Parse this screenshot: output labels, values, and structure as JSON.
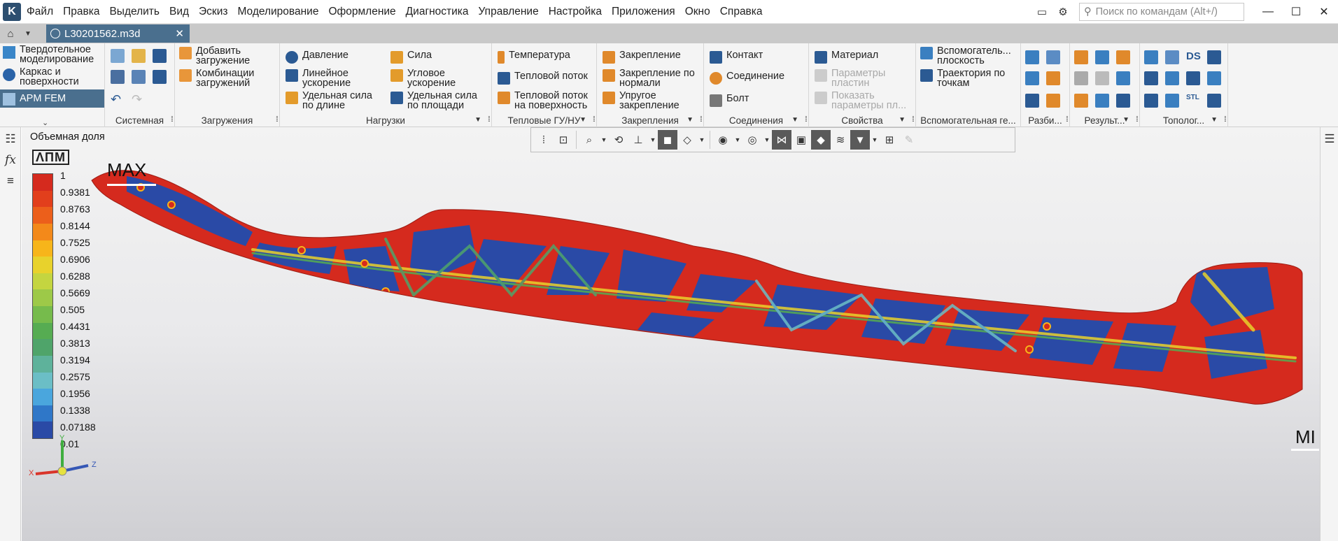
{
  "app": {
    "logo": "K",
    "menu": [
      "Файл",
      "Правка",
      "Выделить",
      "Вид",
      "Эскиз",
      "Моделирование",
      "Оформление",
      "Диагностика",
      "Управление",
      "Настройка",
      "Приложения",
      "Окно",
      "Справка"
    ],
    "search_placeholder": "Поиск по командам (Alt+/)"
  },
  "tabs": {
    "doc_name": "L30201562.m3d"
  },
  "modes": [
    "Твердотельное моделирование",
    "Каркас и поверхности",
    "APM FEM"
  ],
  "ribbon": {
    "groups": {
      "system": "Системная",
      "loads_group": "Загружения",
      "loads": "Нагрузки",
      "thermal": "Тепловые ГУ/НУ",
      "fix": "Закрепления",
      "joints": "Соединения",
      "props": "Свойства",
      "aux": "Вспомогательная ге...",
      "mesh": "Разби...",
      "results": "Результ...",
      "topo": "Тополог..."
    },
    "add_load": "Добавить загружение",
    "combo": "Комбинации загружений",
    "pressure": "Давление",
    "lin_acc": "Линейное ускорение",
    "len_force": "Удельная сила по длине",
    "force": "Сила",
    "ang_acc": "Угловое ускорение",
    "area_force": "Удельная сила по площади",
    "temp": "Температура",
    "heat_flow": "Тепловой поток",
    "heat_flow_surf": "Тепловой поток на поверхность",
    "fixing": "Закрепление",
    "fix_normal": "Закрепление по нормали",
    "elastic": "Упругое закрепление",
    "contact": "Контакт",
    "joint": "Соединение",
    "bolt": "Болт",
    "material": "Материал",
    "plate_params": "Параметры пластин",
    "show_params": "Показать параметры пл...",
    "aux_plane": "Вспомогатель... плоскость",
    "trajectory": "Траектория по точкам",
    "ds": "DS",
    "stl": "STL"
  },
  "viewport": {
    "result_label": "Объемная доля",
    "brand": "ΛΠΜ",
    "max_label": "MAX",
    "min_label": "MI",
    "axis_x": "X",
    "axis_y": "Y",
    "axis_z": "Z"
  },
  "legend": {
    "ticks": [
      "1",
      "0.9381",
      "0.8763",
      "0.8144",
      "0.7525",
      "0.6906",
      "0.6288",
      "0.5669",
      "0.505",
      "0.4431",
      "0.3813",
      "0.3194",
      "0.2575",
      "0.1956",
      "0.1338",
      "0.07188",
      "0.01"
    ],
    "colors": [
      "#d52a1e",
      "#e23f1c",
      "#ec5f1b",
      "#f3891a",
      "#f7b51a",
      "#e8d22c",
      "#c4d540",
      "#9dc948",
      "#76bb4c",
      "#56ac52",
      "#4fa46a",
      "#5eb29b",
      "#6bbec6",
      "#4aa6dd",
      "#2f77c8",
      "#2a4aa6"
    ]
  },
  "colors": {
    "accent": "#4a6f8e",
    "tabbar": "#c9c9c9"
  }
}
